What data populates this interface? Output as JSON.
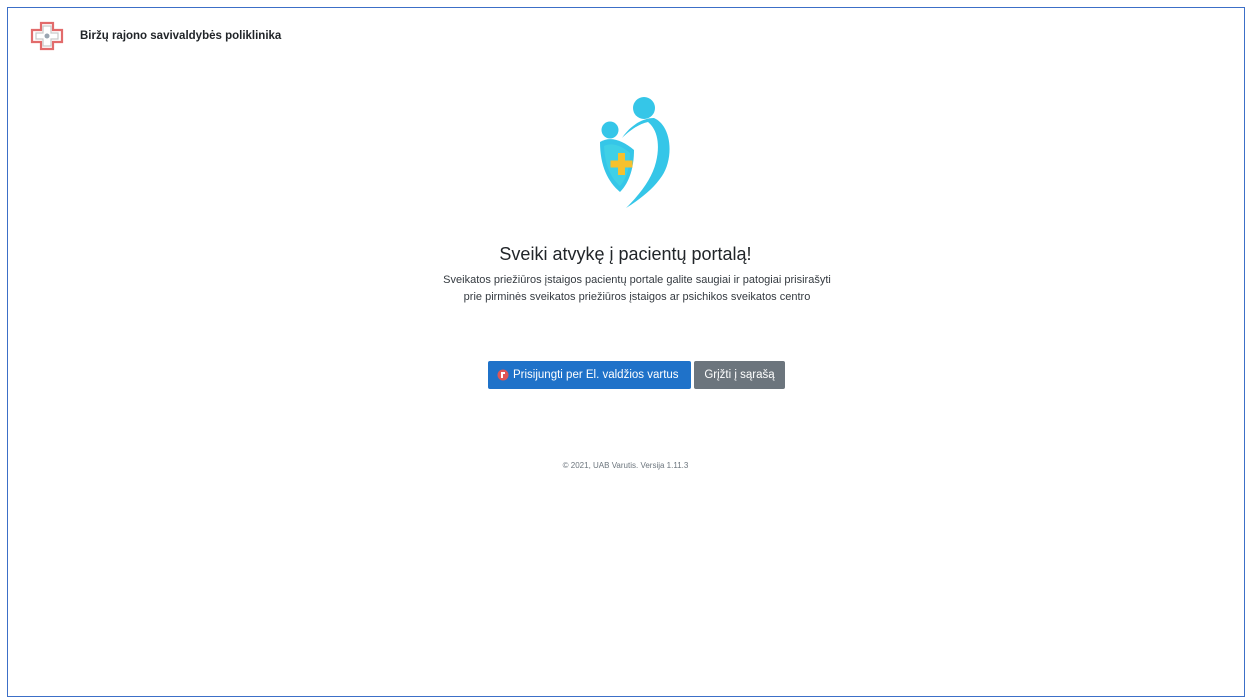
{
  "header": {
    "logo_icon": "clinic-cross-logo",
    "org_name": "Biržų rajono savivaldybės poliklinika"
  },
  "hero": {
    "icon": "patient-care-shield-icon"
  },
  "welcome": {
    "title": "Sveiki atvykę į pacientų portalą!",
    "description": "Sveikatos priežiūros įstaigos pacientų portale galite saugiai ir patogiai prisirašyti prie pirminės sveikatos priežiūros įstaigos ar psichikos sveikatos centro"
  },
  "actions": {
    "login_icon": "gateway-emblem-icon",
    "login_label": "Prisijungti per El. valdžios vartus",
    "back_label": "Grįžti į sąrašą"
  },
  "footer": {
    "text": "© 2021, UAB Varutis. Versija 1.11.3"
  },
  "colors": {
    "primary": "#1f72c9",
    "secondary": "#6c757d",
    "accent_cyan": "#35c6e8",
    "accent_yellow": "#f6c12d",
    "frame": "#3c6fc7"
  }
}
